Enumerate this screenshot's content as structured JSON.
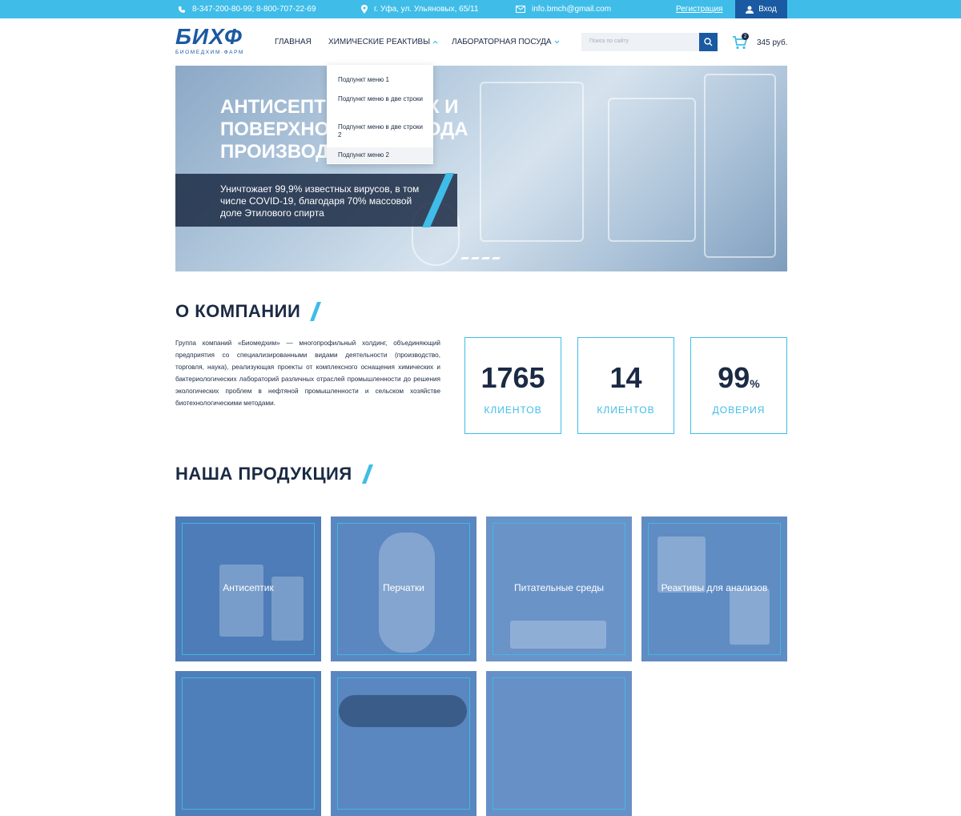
{
  "topbar": {
    "phones": "8-347-200-80-99; 8-800-707-22-69",
    "address": "г. Уфа, ул. Ульяновых, 65/11",
    "email": "info.bmch@gmail.com",
    "register": "Регистрация",
    "login": "Вход"
  },
  "header": {
    "logo_main": "БИХФ",
    "logo_sub": "БИОМЕДХИМ·ФАРМ",
    "nav": [
      "ГЛАВНАЯ",
      "ХИМИЧЕСКИЕ РЕАКТИВЫ",
      "ЛАБОРАТОРНАЯ ПОСУДА"
    ],
    "search_placeholder": "Поиск по сайту",
    "cart_count": "2",
    "cart_total": "345 руб."
  },
  "dropdown": {
    "items": [
      "Подпункт меню 1",
      "Подпункт меню в две строки",
      "Подпункт меню в две строки 2",
      "Подпункт меню 2"
    ]
  },
  "hero": {
    "title": "АНТИСЕПТИК ДЛЯ РУК И ПОВЕРХНОСТЕЙ ЗАВОДА ПРОИЗВОДСТВА",
    "subtitle": "Уничтожает 99,9% известных вирусов, в том числе COVID-19, благодаря 70% массовой доле Этилового спирта",
    "slides_count": 4
  },
  "about": {
    "heading": "О КОМПАНИИ",
    "text": "Группа компаний «Биомедхим» — многопрофильный холдинг, объединяющий предприятия со специализированными видами деятельности (производство, торговля, наука), реализующая проекты от комплексного оснащения химических и бактериологических лабораторий различных отраслей промышленности до решения экологических проблем в нефтяной промышленности и сельском хозяйстве биотехнологическими методами.",
    "stats": [
      {
        "value": "1765",
        "suffix": "",
        "label": "КЛИЕНТОВ"
      },
      {
        "value": "14",
        "suffix": "",
        "label": "КЛИЕНТОВ"
      },
      {
        "value": "99",
        "suffix": "%",
        "label": "ДОВЕРИЯ"
      }
    ]
  },
  "products": {
    "heading": "НАША ПРОДУКЦИЯ",
    "items": [
      "Антисептик",
      "Перчатки",
      "Питательные среды",
      "Реактивы для анализов",
      "",
      "",
      ""
    ]
  },
  "colors": {
    "accent": "#3fbde8",
    "brand": "#1a5aa2",
    "dark": "#1b2a44"
  }
}
